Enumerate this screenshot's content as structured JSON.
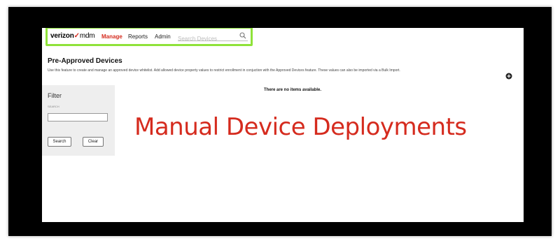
{
  "topbar": {
    "logo_brand": "verizon",
    "logo_check": "✓",
    "logo_product": "mdm",
    "nav": [
      {
        "label": "Manage",
        "active": true
      },
      {
        "label": "Reports",
        "active": false
      },
      {
        "label": "Admin",
        "active": false
      }
    ],
    "search_placeholder": "Search Devices",
    "search_icon": "search-icon",
    "highlight_color": "#8fe23a"
  },
  "page": {
    "title": "Pre-Approved Devices",
    "description": "Use this feature to create and manage an approved device whitelist. Add allowed device property values to restrict enrollment in conjuction with the Approved Devices feature. These values can also be imported via a Bulk Import.",
    "add_icon": "plus-circle-icon"
  },
  "filter": {
    "title": "Filter",
    "field_label": "SEARCH",
    "field_value": "",
    "search_label": "Search",
    "clear_label": "Clear"
  },
  "results": {
    "empty_message": "There are no items available."
  },
  "overlay": {
    "caption": "Manual Device Deployments",
    "color": "#d52b1e"
  },
  "colors": {
    "brand_red": "#d52b1e",
    "frame": "#000000"
  }
}
